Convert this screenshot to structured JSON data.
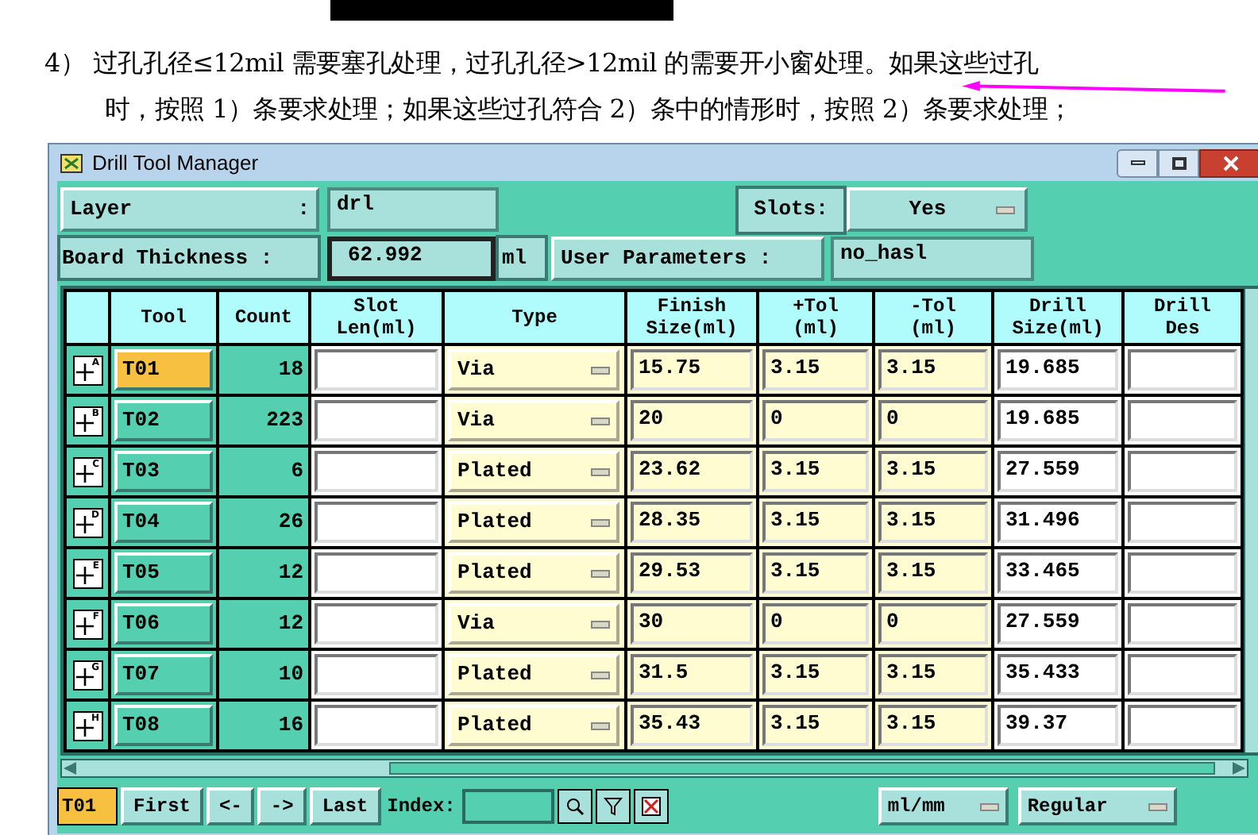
{
  "document": {
    "lines": [
      "4）  过孔孔径≤12mil 需要塞孔处理，过孔孔径>12mil 的需要开小窗处理。如果这些过孔",
      "时，按照 1）条要求处理；如果这些过孔符合 2）条中的情形时，按照 2）条要求处理；"
    ]
  },
  "window": {
    "title": "Drill Tool Manager"
  },
  "params": {
    "layer_label": "Layer",
    "layer_colon": ":",
    "layer_value": "drl",
    "slots_label": "Slots:",
    "slots_value": "Yes",
    "thickness_label": "Board Thickness :",
    "thickness_value": "62.992",
    "thickness_unit": "ml",
    "user_params_label": "User Parameters :",
    "user_params_value": "no_hasl"
  },
  "table": {
    "columns": [
      "Tool",
      "Count",
      "Slot\nLen(ml)",
      "Type",
      "Finish\nSize(ml)",
      "+Tol\n(ml)",
      "-Tol\n(ml)",
      "Drill\nSize(ml)",
      "Drill\nDes"
    ],
    "rows": [
      {
        "marker": "A",
        "tool": "T01",
        "selected": true,
        "count": "18",
        "type": "Via",
        "finish": "15.75",
        "plus_tol": "3.15",
        "minus_tol": "3.15",
        "drill_size": "19.685"
      },
      {
        "marker": "B",
        "tool": "T02",
        "selected": false,
        "count": "223",
        "type": "Via",
        "finish": "20",
        "plus_tol": "0",
        "minus_tol": "0",
        "drill_size": "19.685"
      },
      {
        "marker": "C",
        "tool": "T03",
        "selected": false,
        "count": "6",
        "type": "Plated",
        "finish": "23.62",
        "plus_tol": "3.15",
        "minus_tol": "3.15",
        "drill_size": "27.559"
      },
      {
        "marker": "D",
        "tool": "T04",
        "selected": false,
        "count": "26",
        "type": "Plated",
        "finish": "28.35",
        "plus_tol": "3.15",
        "minus_tol": "3.15",
        "drill_size": "31.496"
      },
      {
        "marker": "E",
        "tool": "T05",
        "selected": false,
        "count": "12",
        "type": "Plated",
        "finish": "29.53",
        "plus_tol": "3.15",
        "minus_tol": "3.15",
        "drill_size": "33.465"
      },
      {
        "marker": "F",
        "tool": "T06",
        "selected": false,
        "count": "12",
        "type": "Via",
        "finish": "30",
        "plus_tol": "0",
        "minus_tol": "0",
        "drill_size": "27.559"
      },
      {
        "marker": "G",
        "tool": "T07",
        "selected": false,
        "count": "10",
        "type": "Plated",
        "finish": "31.5",
        "plus_tol": "3.15",
        "minus_tol": "3.15",
        "drill_size": "35.433"
      },
      {
        "marker": "H",
        "tool": "T08",
        "selected": false,
        "count": "16",
        "type": "Plated",
        "finish": "35.43",
        "plus_tol": "3.15",
        "minus_tol": "3.15",
        "drill_size": "39.37"
      }
    ]
  },
  "footer": {
    "current_tool": "T01",
    "buttons": [
      "First",
      "<-",
      "->",
      "Last"
    ],
    "index_label": "Index:",
    "unit": "ml/mm",
    "mode": "Regular"
  }
}
